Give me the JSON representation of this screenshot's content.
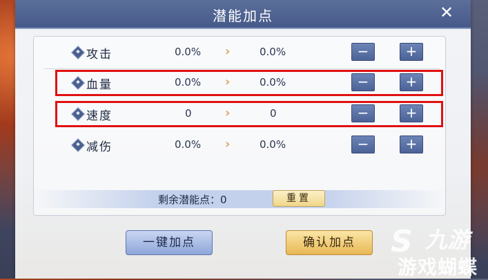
{
  "dialog": {
    "title": "潜能加点",
    "close_label": "✕"
  },
  "stats": [
    {
      "name": "攻击",
      "current": "0.0%",
      "next": "0.0%",
      "minus": "−",
      "plus": "+",
      "highlighted": false
    },
    {
      "name": "血量",
      "current": "0.0%",
      "next": "0.0%",
      "minus": "−",
      "plus": "+",
      "highlighted": true
    },
    {
      "name": "速度",
      "current": "0",
      "next": "0",
      "minus": "−",
      "plus": "+",
      "highlighted": true
    },
    {
      "name": "减伤",
      "current": "0.0%",
      "next": "0.0%",
      "minus": "−",
      "plus": "+",
      "highlighted": false
    }
  ],
  "arrow_glyph": "›",
  "remaining": {
    "label": "剩余潜能点：0",
    "reset_label": "重置"
  },
  "buttons": {
    "auto_label": "一键加点",
    "confirm_label": "确认加点"
  },
  "watermark": {
    "logo_glyph": "S",
    "line1": "九游",
    "line2": "游戏蝴蝶"
  },
  "colors": {
    "title_bar": "#4f6393",
    "highlight": "#e01010",
    "button_blue": "#5c74ad",
    "button_gold": "#e9b755"
  }
}
